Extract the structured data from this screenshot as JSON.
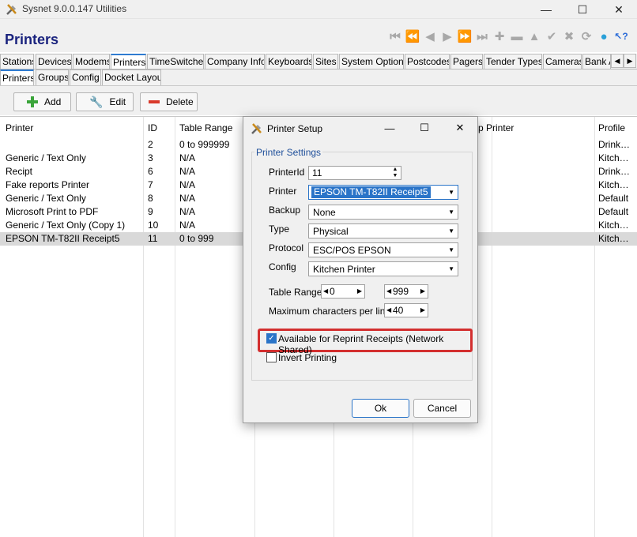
{
  "app": {
    "title": "Sysnet 9.0.0.147 Utilities"
  },
  "page": {
    "title": "Printers"
  },
  "nav_icons": [
    "first-icon",
    "prev-page-icon",
    "prev-icon",
    "next-icon",
    "next-page-icon",
    "last-icon",
    "add-icon",
    "remove-icon",
    "up-icon",
    "accept-icon",
    "cancel-icon",
    "refresh-icon",
    "chat-icon",
    "help-icon"
  ],
  "main_tabs": [
    "Stations",
    "Devices",
    "Modems",
    "Printers",
    "TimeSwitches",
    "Company Info",
    "Keyboards",
    "Sites",
    "System Options",
    "Postcodes",
    "Pagers",
    "Tender Types",
    "Cameras",
    "Bank A"
  ],
  "sub_tabs": [
    "Printers",
    "Groups",
    "Config",
    "Docket Layout"
  ],
  "toolbar": {
    "add": "Add",
    "edit": "Edit",
    "delete": "Delete"
  },
  "grid": {
    "headers": {
      "printer": "Printer",
      "id": "ID",
      "range": "Table Range",
      "backup": "p Printer",
      "profile": "Profile"
    },
    "rows": [
      {
        "printer": "",
        "id": "2",
        "range": "0 to 999999",
        "profile": "Drink…"
      },
      {
        "printer": "Generic / Text Only",
        "id": "3",
        "range": "N/A",
        "profile": "Kitch…"
      },
      {
        "printer": "Recipt",
        "id": "6",
        "range": "N/A",
        "profile": "Drink…"
      },
      {
        "printer": "Fake reports Printer",
        "id": "7",
        "range": "N/A",
        "profile": "Kitch…"
      },
      {
        "printer": "Generic / Text Only",
        "id": "8",
        "range": "N/A",
        "profile": "Default"
      },
      {
        "printer": "Microsoft Print to PDF",
        "id": "9",
        "range": "N/A",
        "profile": "Default"
      },
      {
        "printer": "Generic / Text Only (Copy 1)",
        "id": "10",
        "range": "N/A",
        "profile": "Kitch…"
      },
      {
        "printer": "EPSON TM-T82II Receipt5",
        "id": "11",
        "range": "0 to 999",
        "profile": "Kitch…"
      }
    ]
  },
  "dialog": {
    "title": "Printer Setup",
    "group_label": "Printer Settings",
    "printer_id_label": "PrinterId",
    "printer_id_value": "11",
    "printer_label": "Printer",
    "printer_value": "EPSON TM-T82II Receipt5",
    "backup_label": "Backup",
    "backup_value": "None",
    "type_label": "Type",
    "type_value": "Physical",
    "protocol_label": "Protocol",
    "protocol_value": "ESC/POS EPSON",
    "config_label": "Config",
    "config_value": "Kitchen Printer",
    "table_range_label": "Table Range",
    "range_from": "0",
    "range_to": "999",
    "max_chars_label": "Maximum characters per line",
    "max_chars_value": "40",
    "reprint_label": "Available for Reprint Receipts (Network Shared)",
    "reprint_checked": true,
    "invert_label": "Invert Printing",
    "invert_checked": false,
    "ok": "Ok",
    "cancel": "Cancel"
  }
}
